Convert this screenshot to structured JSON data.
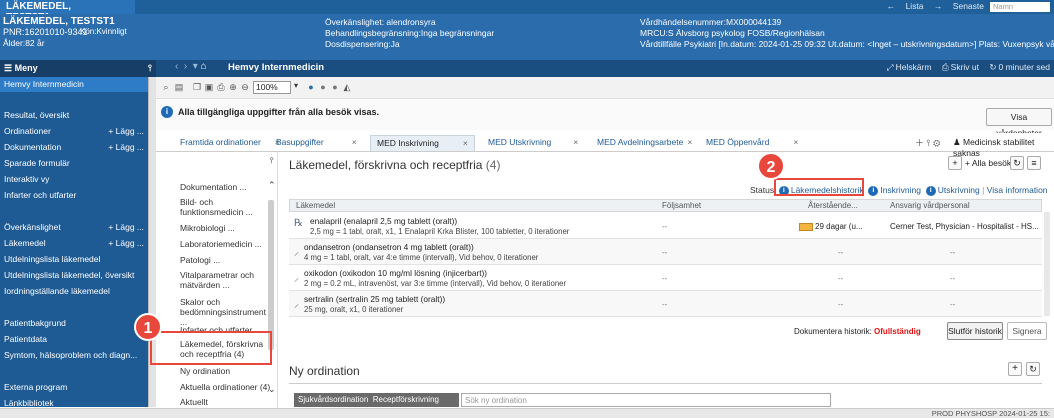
{
  "top": {
    "tab_title": "LÄKEMEDEL, TESTST1",
    "tab_close": "×",
    "lista": "Lista",
    "senaste": "Senaste",
    "name_placeholder": "Namn"
  },
  "patient": {
    "name": "LÄKEMEDEL, TESTST1",
    "pnr": "PNR:16201010-9341",
    "gender": "Kön:Kvinnligt",
    "age": "Ålder:82 år",
    "overkanslighet": "Överkänslighet: alendronsyra",
    "begransning": "Behandlingsbegränsning:Inga begränsningar",
    "dosdispensering": "Dosdispensering:Ja",
    "vardhandelse": "Vårdhändelsenummer:MX000044139",
    "mrcu": "MRCU:S Älvsborg psykolog FOSB/Regionhälsan",
    "vardtillfalle": "Vårdtillfälle Psykiatri [In.datum: 2024-01-25 09:32 Ut.datum: <Inget – utskrivningsdatum>] Plats: Vuxenpsyk vårda"
  },
  "menu": {
    "title": "Meny",
    "items": [
      {
        "label": "Hemvy Internmedicin",
        "add": ""
      },
      {
        "label": "Resultat, översikt",
        "add": ""
      },
      {
        "label": "Ordinationer",
        "add": "+ Lägg ..."
      },
      {
        "label": "Dokumentation",
        "add": "+ Lägg ..."
      },
      {
        "label": "Sparade formulär",
        "add": ""
      },
      {
        "label": "Interaktiv vy",
        "add": ""
      },
      {
        "label": "Infarter och utfarter",
        "add": ""
      },
      {
        "label": "Överkänslighet",
        "add": "+ Lägg ..."
      },
      {
        "label": "Läkemedel",
        "add": "+ Lägg ..."
      },
      {
        "label": "Utdelningslista läkemedel",
        "add": ""
      },
      {
        "label": "Utdelningslista läkemedel, översikt",
        "add": ""
      },
      {
        "label": "Iordningställande läkemedel",
        "add": ""
      },
      {
        "label": "Patientbakgrund",
        "add": ""
      },
      {
        "label": "Patientdata",
        "add": ""
      },
      {
        "label": "Symtom, hälsoproblem och diagn...",
        "add": ""
      },
      {
        "label": "Externa program",
        "add": ""
      },
      {
        "label": "Länkbibliotek",
        "add": ""
      }
    ]
  },
  "nav": {
    "title": "Hemvy Internmedicin",
    "helskarm": "Helskärm",
    "skriv_ut": "Skriv ut",
    "minuter": "0 minuter sed"
  },
  "toolbar": {
    "zoom": "100%"
  },
  "banner": {
    "info": "Alla tillgängliga uppgifter från alla besök visas.",
    "visa_vardenheter": "Visa vårdenheter"
  },
  "tabs": [
    {
      "label": "Framtida ordinationer"
    },
    {
      "label": "Basuppgifter"
    },
    {
      "label": "MED Inskrivning"
    },
    {
      "label": "MED Utskrivning"
    },
    {
      "label": "MED Avdelningsarbete"
    },
    {
      "label": "MED Öppenvård"
    }
  ],
  "tab_close": "×",
  "stabilitet": "Medicinsk stabilitet saknas",
  "subnav": {
    "items": [
      "Dokumentation ...",
      "Bild- och funktionsmedicin ...",
      "Mikrobiologi ...",
      "Laboratoriemedicin ...",
      "Patologi ...",
      "Vitalparametrar och mätvärden ...",
      "Skalor och bedömningsinstrument ...",
      "Infarter och utfarter",
      "Läkemedel, förskrivna och receptfria (4)",
      "Ny ordination",
      "Aktuella ordinationer (4)",
      "Aktuellt"
    ]
  },
  "main": {
    "title": "Läkemedel, förskrivna och receptfria",
    "count": "(4)",
    "alla_besok": "+ Alla besök",
    "status_label": "Status:",
    "lakemedelshistorik": "Läkemedelshistorik",
    "inskrivning": "Inskrivning",
    "utskrivning": "Utskrivning",
    "visa_information": "Visa information",
    "columns": [
      "Läkemedel",
      "Följsamhet",
      "Återstående...",
      "Ansvarig vårdpersonal"
    ],
    "rows": [
      {
        "title": "enalapril (enalapril 2,5 mg tablett (oralt))",
        "sub": "2,5 mg = 1 tabl, oralt, x1, 1 Enalapril Krka Blister, 100 tabletter, 0 iterationer",
        "folj": "--",
        "aterstaende": "29 dagar (u...",
        "ansvarig": "Cerner Test, Physician - Hospitalist - HS..."
      },
      {
        "title": "ondansetron (ondansetron 4 mg tablett (oralt))",
        "sub": "4 mg = 1 tabl, oralt, var 4:e timme (intervall), Vid behov, 0 iterationer",
        "folj": "--",
        "aterstaende": "--",
        "ansvarig": "--"
      },
      {
        "title": "oxikodon (oxikodon 10 mg/ml lösning (injicerbart))",
        "sub": "2 mg = 0.2 mL, intravenöst, var 3:e timme (intervall), Vid behov, 0 iterationer",
        "folj": "--",
        "aterstaende": "--",
        "ansvarig": "--"
      },
      {
        "title": "sertralin (sertralin 25 mg tablett (oralt))",
        "sub": "25 mg, oralt, x1, 0 iterationer",
        "folj": "--",
        "aterstaende": "--",
        "ansvarig": "--"
      }
    ],
    "dokumentera_historik": "Dokumentera historik:",
    "ofullstandig": "Ofullständig",
    "slutfor_historik": "Slutför historik",
    "signera": "Signera"
  },
  "ny_ordination": {
    "title": "Ny ordination",
    "tab1": "Sjukvårdsordination",
    "tab2": "Receptförskrivning",
    "search_placeholder": "Sök ny ordination"
  },
  "statusbar": {
    "prod": "PROD  PHYSHOSP  2024-01-25  15:"
  },
  "callouts": [
    "1",
    "2"
  ]
}
